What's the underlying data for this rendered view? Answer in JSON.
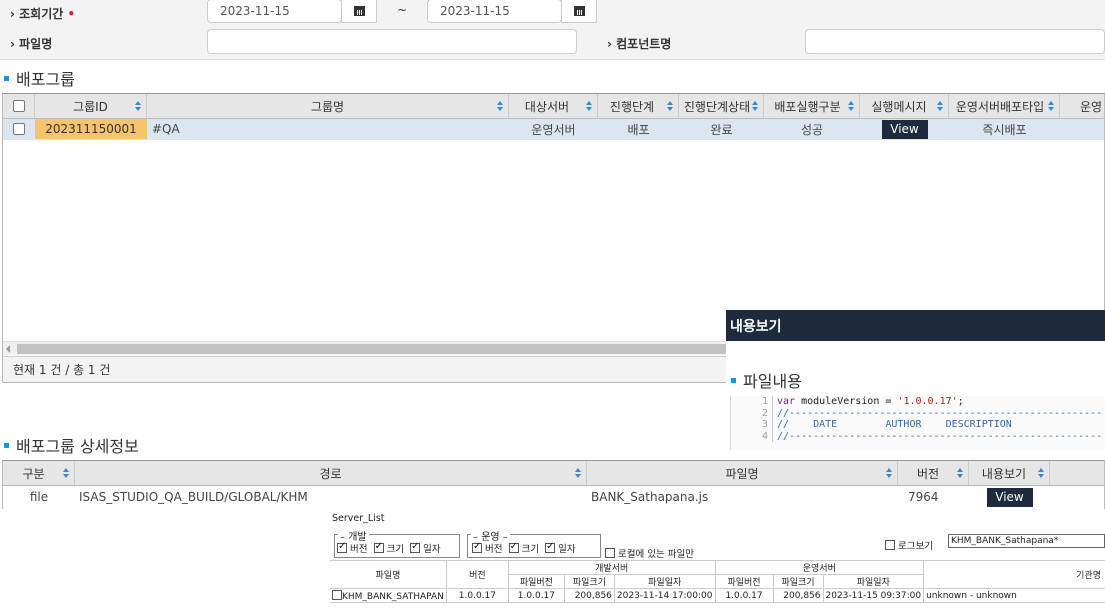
{
  "filter": {
    "period_label": "조회기간",
    "required_mark": "•",
    "date_from": "2023-11-15",
    "date_to": "2023-11-15",
    "range_sep": "~",
    "file_label": "파일명",
    "file_value": "",
    "component_label": "컴포넌트명",
    "component_value": ""
  },
  "group": {
    "title": "배포그룹",
    "columns": [
      "그룹ID",
      "그룹명",
      "대상서버",
      "진행단계",
      "진행단계상태",
      "배포실행구분",
      "실행메시지",
      "운영서버배포타입",
      "운영"
    ],
    "rows": [
      {
        "id": "202311150001",
        "name": "#QA",
        "server": "운영서버",
        "stage": "배포",
        "stage_status": "완료",
        "exec_type": "성공",
        "message_button": "View",
        "deploy_type": "즉시배포"
      }
    ],
    "count_text": "현재 1 건 / 총 1 건"
  },
  "popup": {
    "title": "내용보기",
    "section_title": "파일내용",
    "code_lines": [
      {
        "n": "1",
        "parts": [
          {
            "c": "kw",
            "t": "var"
          },
          {
            "c": "",
            "t": " moduleVersion = "
          },
          {
            "c": "str",
            "t": "'1.0.0.17'"
          },
          {
            "c": "",
            "t": ";"
          }
        ]
      },
      {
        "n": "2",
        "parts": [
          {
            "c": "cm",
            "t": "//----------------------------------------------------"
          }
        ]
      },
      {
        "n": "3",
        "parts": [
          {
            "c": "cm",
            "t": "//    DATE        AUTHOR    DESCRIPTION"
          }
        ]
      },
      {
        "n": "4",
        "parts": [
          {
            "c": "cm",
            "t": "//----------------------------------------------------"
          }
        ]
      }
    ]
  },
  "detail": {
    "title": "배포그룹 상세정보",
    "columns": [
      "구분",
      "경로",
      "파일명",
      "버전",
      "내용보기"
    ],
    "rows": [
      {
        "type": "file",
        "path": "ISAS_STUDIO_QA_BUILD/GLOBAL/KHM",
        "filename": "BANK_Sathapana.js",
        "version": "7964",
        "view_button": "View"
      }
    ]
  },
  "server_list": {
    "title": "Server_List",
    "dev_legend": "개발",
    "ops_legend": "운영",
    "opt_version": "버전",
    "opt_size": "크기",
    "opt_date": "일자",
    "local_only": "로컬에 있는 파일만",
    "log_label": "로그보기",
    "log_value": "KHM_BANK_Sathapana*",
    "headers": {
      "filename": "파일명",
      "version": "버전",
      "dev_server": "개발서버",
      "ops_server": "운영서버",
      "file_version": "파일버전",
      "file_size": "파일크기",
      "file_date": "파일일자",
      "org": "기관명"
    },
    "row": {
      "filename": "KHM_BANK_SATHAPAN",
      "version": "1.0.0.17",
      "dev_version": "1.0.0.17",
      "dev_size": "200,856",
      "dev_date": "2023-11-14 17:00:00",
      "ops_version": "1.0.0.17",
      "ops_size": "200,856",
      "ops_date": "2023-11-15 09:37:00",
      "org": "unknown - unknown"
    }
  }
}
